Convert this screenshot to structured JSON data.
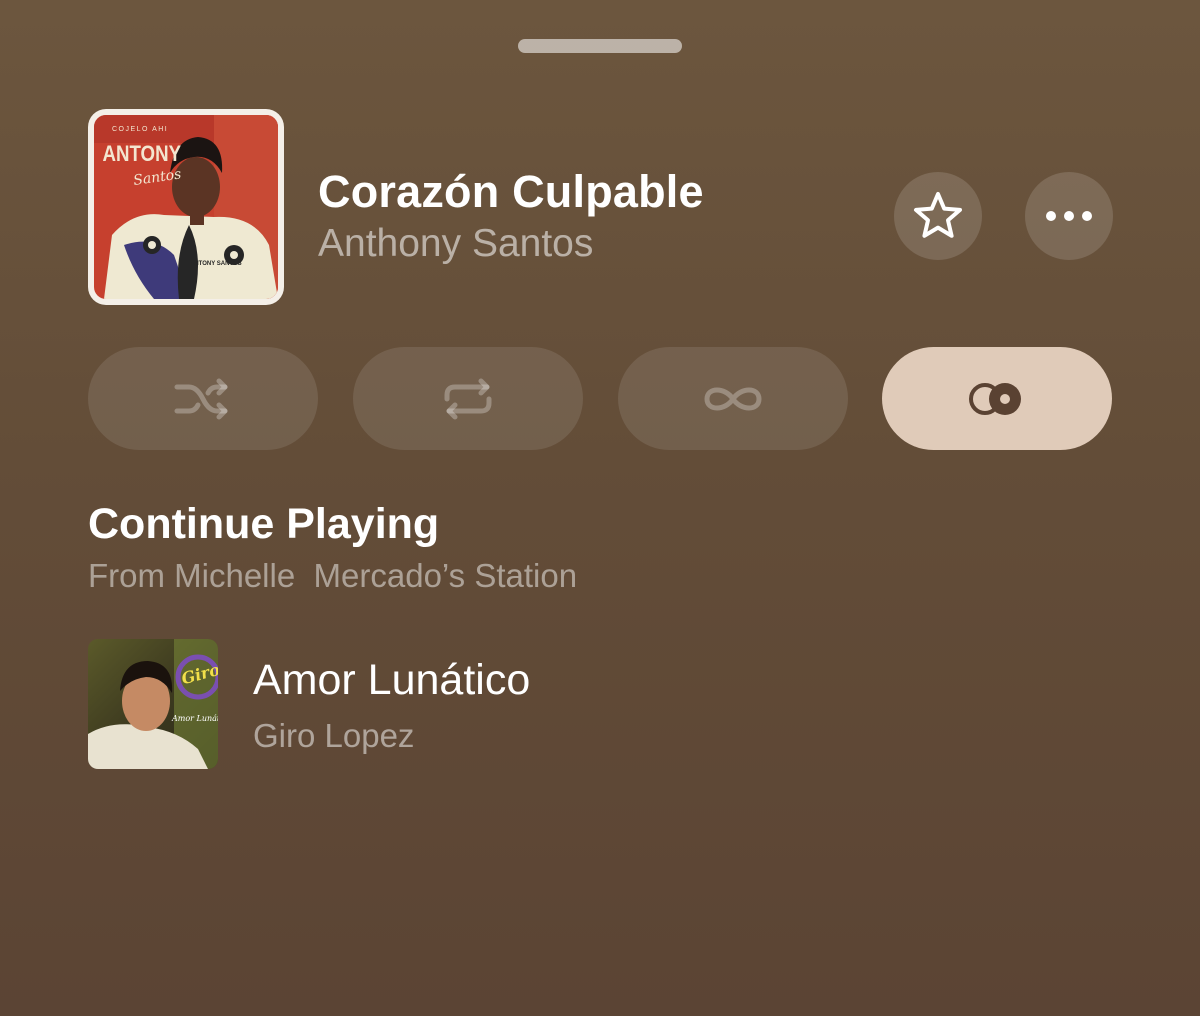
{
  "now_playing": {
    "title": "Corazón Culpable",
    "artist": "Anthony Santos",
    "artwork": {
      "subtitle_text": "COJELO AHI",
      "artist_text": "ANTONY",
      "script_text": "Santos",
      "jacket_text": "ANTONY SANTOS"
    },
    "favorite_icon": "star-icon",
    "more_icon": "ellipsis-icon"
  },
  "playback_modes": [
    {
      "icon": "shuffle-icon",
      "active": false
    },
    {
      "icon": "repeat-icon",
      "active": false
    },
    {
      "icon": "infinity-icon",
      "active": false
    },
    {
      "icon": "crossfade-icon",
      "active": true
    }
  ],
  "continue_playing": {
    "title": "Continue Playing",
    "subtitle": "From Michelle  Mercado’s Station",
    "items": [
      {
        "title": "Amor Lunático",
        "artist": "Giro Lopez",
        "artwork": {
          "logo_text": "Giro",
          "album_text": "Amor Lunático"
        }
      }
    ]
  },
  "colors": {
    "background": "#634d38",
    "active_pill": "#e0cbb9",
    "active_icon": "#5a4232"
  }
}
